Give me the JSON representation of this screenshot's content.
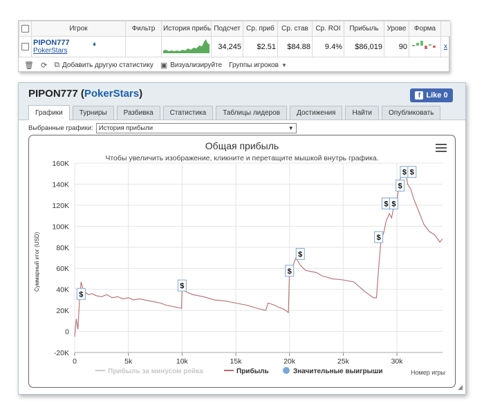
{
  "stats_table": {
    "headers": [
      "Игрок",
      "Фильтр",
      "История прибы",
      "Подсчет",
      "Ср. приб",
      "Ср. став",
      "Ср. ROI",
      "Прибыль",
      "Урове",
      "Форма"
    ],
    "row": {
      "player_name": "PIPON777",
      "room": "PokerStars",
      "count": "34,245",
      "avg_profit": "$2.51",
      "avg_stake": "$84.88",
      "avg_roi": "9.4%",
      "profit": "$86,019",
      "level": "90",
      "remove": "x"
    },
    "toolbar": {
      "add_stat": "Добавить другую статистику",
      "visualize": "Визуализируйте",
      "groups": "Группы игроков"
    }
  },
  "window": {
    "title_name": "PIPON777",
    "title_room": "PokerStars",
    "fb_like": "Like 0",
    "tabs": [
      "Графики",
      "Турниры",
      "Разбивка",
      "Статистика",
      "Таблицы лидеров",
      "Достижения",
      "Найти",
      "Опубликовать"
    ],
    "selected_charts_label": "Выбранные графики:",
    "selected_chart_value": "История прибыли"
  },
  "chart_data": {
    "type": "line",
    "title": "Общая прибыль",
    "subtitle": "Чтобы увеличить изображение, кликните и перетащите мышкой внутрь графика.",
    "ylabel": "Суммарный итог (USD)",
    "xlabel": "Номер игры",
    "xlim": [
      0,
      34245
    ],
    "ylim": [
      -20000,
      160000
    ],
    "x_ticks": [
      0,
      5000,
      10000,
      15000,
      20000,
      25000,
      30000
    ],
    "x_tick_labels": [
      "0",
      "5k",
      "10k",
      "15k",
      "20k",
      "25k",
      "30k"
    ],
    "y_ticks": [
      -20000,
      0,
      20000,
      40000,
      60000,
      80000,
      100000,
      120000,
      140000,
      160000
    ],
    "y_tick_labels": [
      "-20K",
      "0",
      "20K",
      "40K",
      "60K",
      "80K",
      "100K",
      "120K",
      "140K",
      "160K"
    ],
    "legend": [
      "Прибыль за минусом рейка",
      "Прибыль",
      "Значительные выигрыши"
    ],
    "legend_placement": "bottom",
    "series": [
      {
        "name": "Прибыль",
        "color": "#b86a6a",
        "x": [
          0,
          150,
          300,
          450,
          600,
          700,
          800,
          1000,
          1300,
          1600,
          2000,
          2500,
          3000,
          3500,
          4000,
          4500,
          5000,
          5500,
          6000,
          6500,
          7000,
          7500,
          8000,
          8500,
          9000,
          9500,
          9950,
          10000,
          10300,
          11000,
          12000,
          13000,
          14000,
          15000,
          16000,
          17000,
          17800,
          18000,
          18600,
          19000,
          19500,
          19900,
          20000,
          20300,
          20600,
          21000,
          21500,
          22000,
          22500,
          23000,
          24000,
          25000,
          26000,
          27000,
          27800,
          28100,
          28300,
          28500,
          28800,
          29000,
          29300,
          29500,
          29700,
          30000,
          30300,
          30500,
          30800,
          31000,
          31300,
          31600,
          32000,
          32500,
          33000,
          33500,
          34000,
          34245
        ],
        "y": [
          -5000,
          12000,
          2000,
          30000,
          47000,
          43000,
          38000,
          37000,
          35000,
          36000,
          34000,
          33000,
          35000,
          32000,
          33000,
          31000,
          32000,
          30000,
          31000,
          30000,
          29000,
          28000,
          27000,
          25000,
          24000,
          23000,
          22000,
          41000,
          38000,
          35000,
          33000,
          30000,
          29000,
          27000,
          25000,
          22000,
          20000,
          27000,
          25000,
          23000,
          21000,
          18000,
          58000,
          62000,
          70000,
          63000,
          58000,
          57000,
          56000,
          53000,
          50000,
          49000,
          47000,
          38000,
          32000,
          32000,
          60000,
          85000,
          95000,
          105000,
          112000,
          108000,
          118000,
          125000,
          145000,
          150000,
          152000,
          140000,
          135000,
          125000,
          115000,
          102000,
          95000,
          92000,
          85000,
          88000
        ]
      }
    ],
    "big_wins": [
      {
        "x": 600,
        "y": 35000,
        "label": "$"
      },
      {
        "x": 10000,
        "y": 43000,
        "label": "$"
      },
      {
        "x": 20000,
        "y": 57000,
        "label": "$"
      },
      {
        "x": 21000,
        "y": 73000,
        "label": "$"
      },
      {
        "x": 28300,
        "y": 89000,
        "label": "$"
      },
      {
        "x": 29000,
        "y": 121000,
        "label": "$"
      },
      {
        "x": 29700,
        "y": 121000,
        "label": "$"
      },
      {
        "x": 30300,
        "y": 138000,
        "label": "$"
      },
      {
        "x": 30700,
        "y": 151000,
        "label": "$"
      },
      {
        "x": 31400,
        "y": 151000,
        "label": "$"
      }
    ]
  }
}
